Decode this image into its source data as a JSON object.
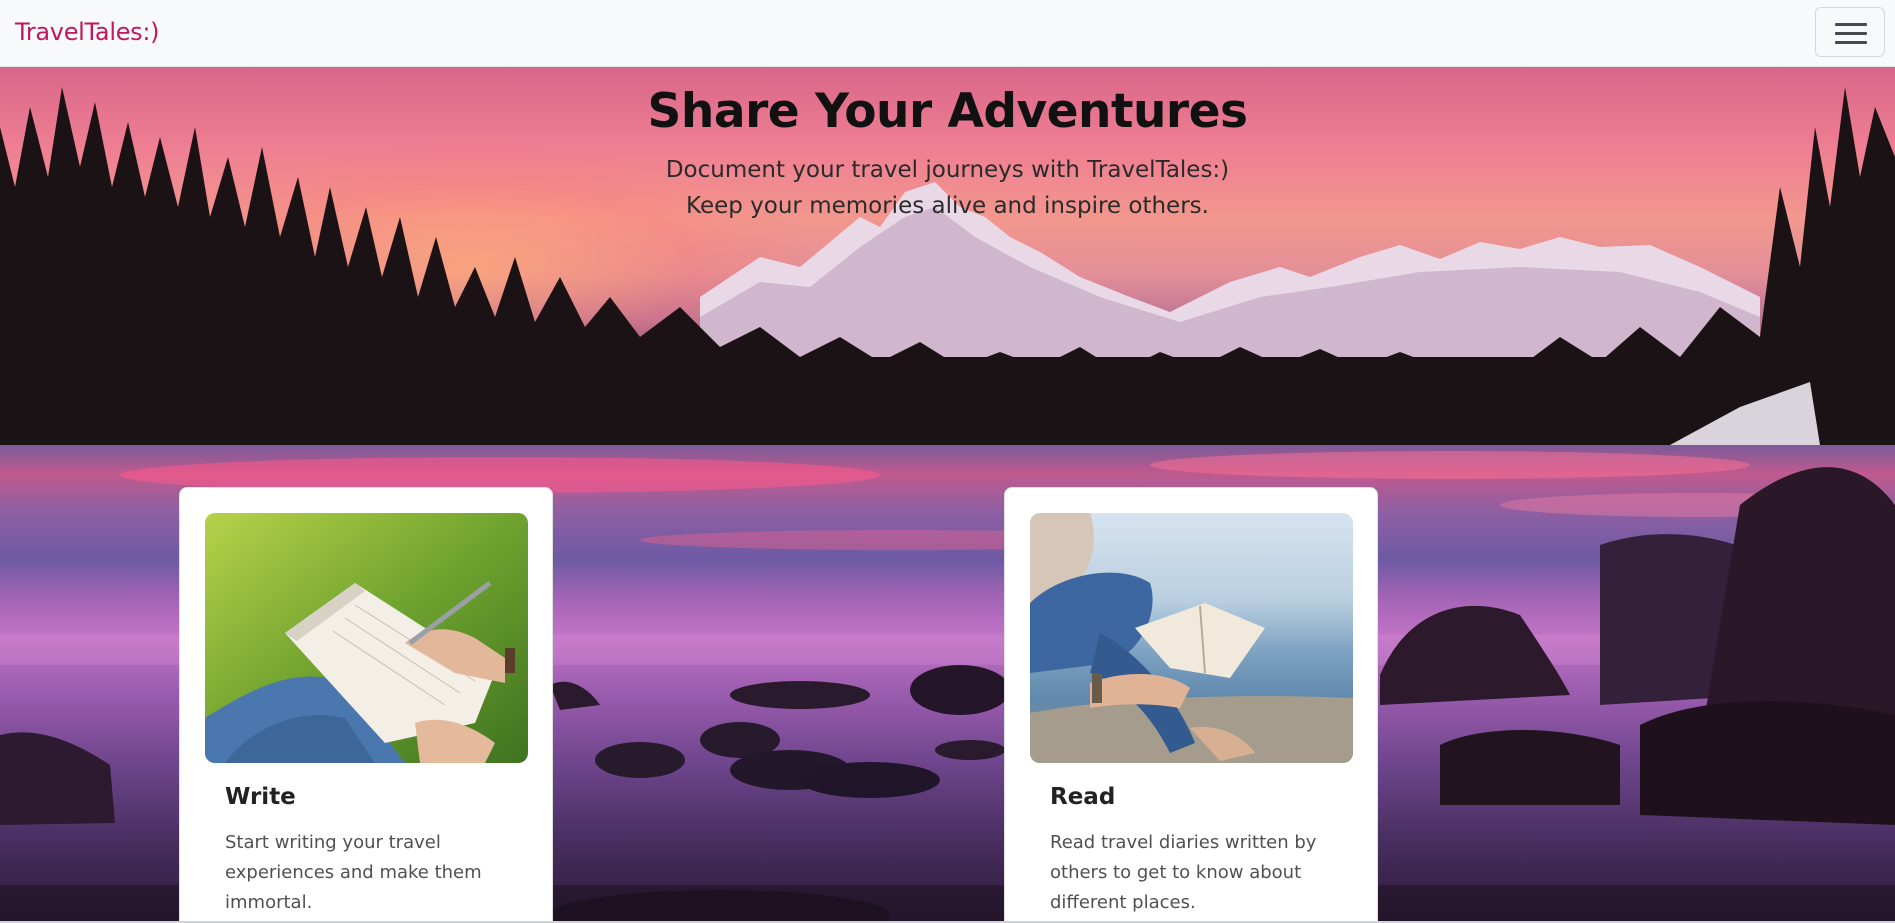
{
  "navbar": {
    "brand": "TravelTales:)",
    "toggler_icon": "hamburger-menu-icon"
  },
  "hero": {
    "title": "Share Your Adventures",
    "line1": "Document your travel journeys with TravelTales:)",
    "line2": "Keep your memories alive and inspire others."
  },
  "cards": [
    {
      "title": "Write",
      "text": "Start writing your travel experiences and make them immortal."
    },
    {
      "title": "Read",
      "text": "Read travel diaries written by others to get to know about different places."
    }
  ],
  "colors": {
    "brand": "#c2185b",
    "navbar_bg": "#f8f9fa",
    "card_bg": "#ffffff"
  }
}
